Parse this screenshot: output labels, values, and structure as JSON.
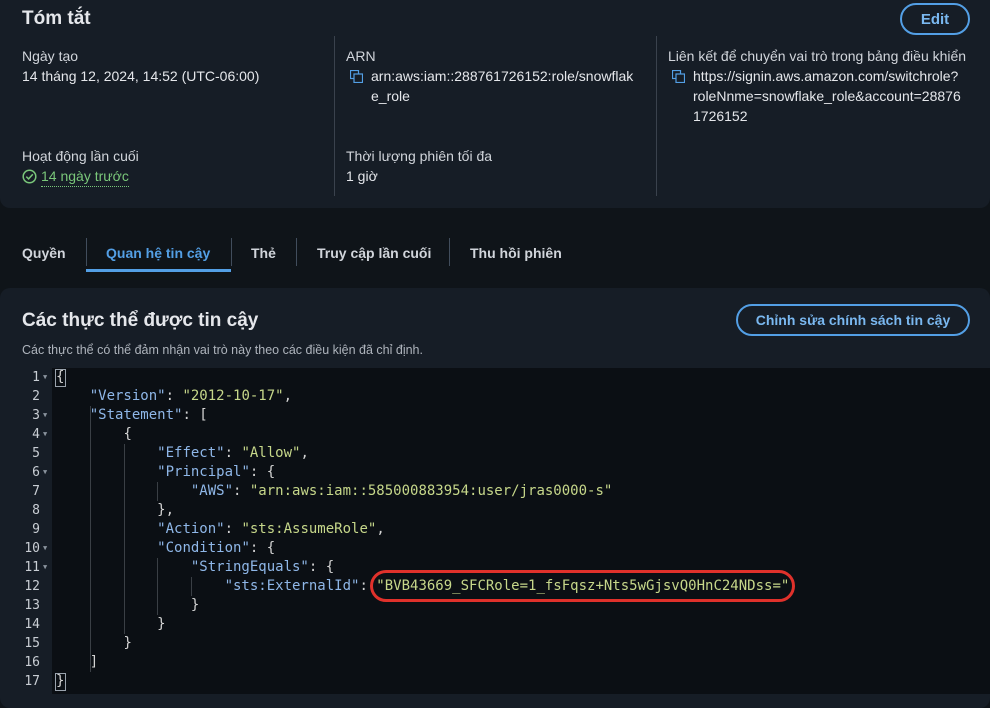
{
  "summary": {
    "title": "Tóm tắt",
    "edit_label": "Edit",
    "created_label": "Ngày tạo",
    "created_value": "14 tháng 12, 2024, 14:52 (UTC-06:00)",
    "arn_label": "ARN",
    "arn_line1": "arn:aws:iam::288761726152:role/snowflak",
    "arn_line2": "e_role",
    "link_label": "Liên kết để chuyển vai trò trong bảng điều khiển",
    "link_line1": "https://signin.aws.amazon.com/switchrole?",
    "link_line2": "roleNnme=snowflake_role&account=28876",
    "link_line3": "1726152",
    "last_activity_label": "Hoạt động lần cuối",
    "last_activity_value": "14 ngày trước",
    "max_session_label": "Thời lượng phiên tối đa",
    "max_session_value": "1 giờ"
  },
  "tabs": [
    {
      "label": "Quyền"
    },
    {
      "label": "Quan hệ tin cậy"
    },
    {
      "label": "Thẻ"
    },
    {
      "label": "Truy cập lần cuối"
    },
    {
      "label": "Thu hồi phiên"
    }
  ],
  "active_tab": "Quan hệ tin cậy",
  "trusted": {
    "title": "Các thực thể được tin cậy",
    "description": "Các thực thể có thể đảm nhận vai trò này theo các điều kiện đã chỉ định.",
    "edit_policy_label": "Chỉnh sửa chính sách tin cậy"
  },
  "code": {
    "line_numbers": [
      "1",
      "2",
      "3",
      "4",
      "5",
      "6",
      "7",
      "8",
      "9",
      "10",
      "11",
      "12",
      "13",
      "14",
      "15",
      "16",
      "17"
    ],
    "l1": "{",
    "l2_key": "\"Version\"",
    "l2_val": "\"2012-10-17\"",
    "l3_key": "\"Statement\"",
    "l3_rest": ": [",
    "l4": "{",
    "l5_key": "\"Effect\"",
    "l5_val": "\"Allow\"",
    "l6_key": "\"Principal\"",
    "l6_rest": ": {",
    "l7_key": "\"AWS\"",
    "l7_val": "\"arn:aws:iam::585000883954:user/jras0000-s\"",
    "l8": "},",
    "l9_key": "\"Action\"",
    "l9_val": "\"sts:AssumeRole\"",
    "l10_key": "\"Condition\"",
    "l10_rest": ": {",
    "l11_key": "\"StringEquals\"",
    "l11_rest": ": {",
    "l12_key": "\"sts:ExternalId\"",
    "l12_val": "\"BVB43669_SFCRole=1_fsFqsz+Nts5wGjsvQ0HnC24NDss=\"",
    "l13": "}",
    "l14": "}",
    "l15": "}",
    "l16": "]",
    "l17": "}"
  },
  "colors": {
    "accent": "#539fe5",
    "success": "#7ac77a",
    "highlight": "#e0312b"
  }
}
